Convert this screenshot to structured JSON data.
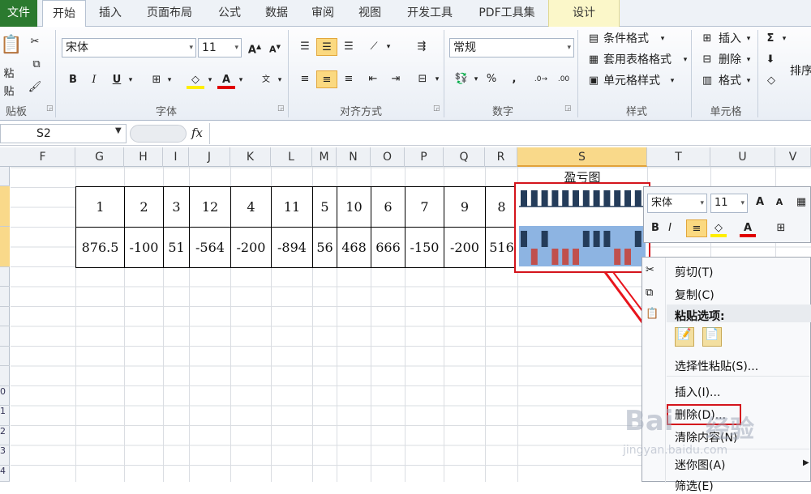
{
  "tabs": {
    "file": "文件",
    "home": "开始",
    "insert": "插入",
    "layout": "页面布局",
    "formula": "公式",
    "data": "数据",
    "review": "审阅",
    "view": "视图",
    "dev": "开发工具",
    "pdf": "PDF工具集",
    "design": "设计"
  },
  "ribbon": {
    "clipboard": {
      "paste": "粘贴",
      "label": "贴板"
    },
    "font": {
      "name": "宋体",
      "size": "11",
      "label": "字体",
      "bold": "B",
      "italic": "I",
      "underline": "U"
    },
    "align": {
      "label": "对齐方式"
    },
    "number": {
      "format": "常规",
      "label": "数字",
      "percent": "%",
      "comma": ","
    },
    "styles": {
      "conditional": "条件格式",
      "table": "套用表格格式",
      "cell": "单元格样式",
      "label": "样式"
    },
    "cells": {
      "insert": "插入",
      "delete": "删除",
      "format": "格式",
      "label": "单元格"
    },
    "editing": {
      "sigma": "Σ",
      "sort": "排序"
    }
  },
  "formula_bar": {
    "name_box": "S2",
    "fx": "fx",
    "value": ""
  },
  "columns": [
    "F",
    "G",
    "H",
    "I",
    "J",
    "K",
    "L",
    "M",
    "N",
    "O",
    "P",
    "Q",
    "R",
    "S",
    "T",
    "U",
    "V"
  ],
  "rows": [
    "",
    "",
    "",
    "",
    "",
    "",
    "",
    "",
    "",
    "0",
    "1",
    "2",
    "3",
    "4"
  ],
  "sheet": {
    "title": "盈亏图",
    "row1": [
      "1",
      "2",
      "3",
      "12",
      "4",
      "11",
      "5",
      "10",
      "6",
      "7",
      "9",
      "8"
    ],
    "row2": [
      "876.5",
      "-100",
      "51",
      "-564",
      "-200",
      "-894",
      "56",
      "468",
      "666",
      "-150",
      "-200",
      "516"
    ]
  },
  "sparkline": {
    "positive_color": "#243c5a",
    "negative_color": "#c0504d",
    "band_color": "#8db4e2",
    "top_bars": [
      1,
      1,
      1,
      1,
      1,
      1,
      1,
      1,
      1,
      1,
      1,
      1
    ],
    "bottom_values": [
      876.5,
      -100,
      51,
      -564,
      -200,
      -894,
      56,
      468,
      666,
      -150,
      -200,
      516
    ]
  },
  "mini_toolbar": {
    "font": "宋体",
    "size": "11"
  },
  "context_menu": {
    "cut": "剪切(T)",
    "copy": "复制(C)",
    "paste_options": "粘贴选项:",
    "paste_special": "选择性粘贴(S)...",
    "insert": "插入(I)...",
    "delete": "删除(D)...",
    "clear": "清除内容(N)",
    "sparkline": "迷你图(A)",
    "filter": "筛选(E)"
  },
  "watermark": {
    "brand": "Bai",
    "brand2": "经验",
    "url": "jingyan.baidu.com"
  }
}
